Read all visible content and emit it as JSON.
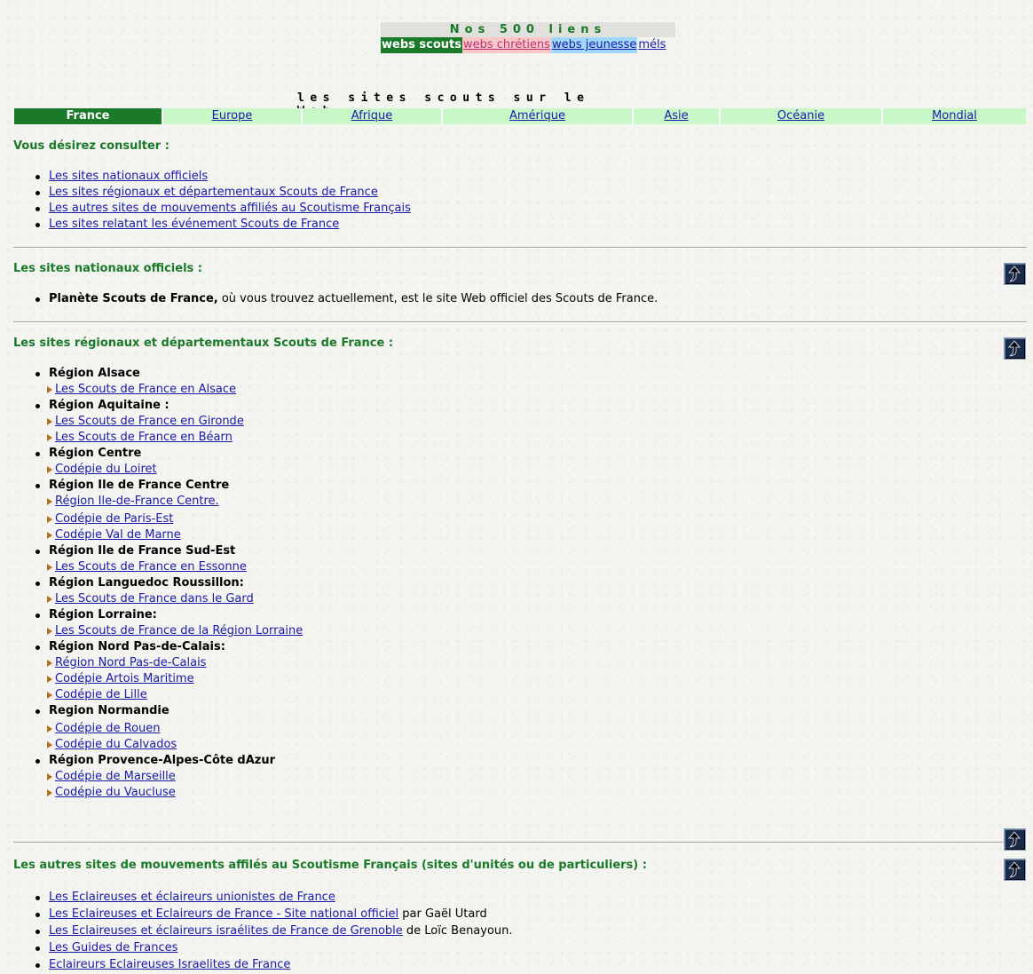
{
  "top": {
    "title": "Nos 500 liens",
    "tabs": [
      "webs scouts",
      "webs chrétiens",
      "webs jeunesse",
      "méls"
    ]
  },
  "headline": "les sites scouts sur le Web",
  "regions": [
    "France",
    "Europe",
    "Afrique",
    "Amérique",
    "Asie",
    "Océanie",
    "Mondial"
  ],
  "intro": {
    "title": "Vous désirez consulter :",
    "items": [
      "Les sites nationaux officiels",
      "Les sites régionaux et départementaux Scouts de France",
      "Les autres sites de mouvements affiliés au Scoutisme Français",
      "Les sites relatant les événement Scouts de France"
    ]
  },
  "national": {
    "title": "Les sites nationaux officiels :",
    "bold": "Planète Scouts de France,",
    "text": " où vous trouvez actuellement, est le site Web officiel des Scouts de France."
  },
  "regional": {
    "title": "Les sites régionaux et départementaux Scouts de France :",
    "groups": [
      {
        "name": "Région Alsace",
        "links": [
          "Les Scouts de France en Alsace"
        ]
      },
      {
        "name": "Région Aquitaine :",
        "links": [
          "Les Scouts de France en Gironde",
          "Les Scouts de France en Béarn"
        ]
      },
      {
        "name": "Région Centre",
        "links": [
          "Codépie du Loiret"
        ]
      },
      {
        "name": "Région Ile de France Centre",
        "links": [
          "Région Ile-de-France Centre.",
          "Codépie de Paris-Est",
          "Codépie Val de Marne"
        ]
      },
      {
        "name": "Région Ile de France Sud-Est",
        "links": [
          "Les Scouts de France en Essonne"
        ]
      },
      {
        "name": "Région Languedoc Roussillon:",
        "links": [
          "Les Scouts de France dans le Gard"
        ]
      },
      {
        "name": "Région Lorraine:",
        "links": [
          "Les Scouts de France de la Région Lorraine"
        ]
      },
      {
        "name": "Région Nord Pas-de-Calais:",
        "links": [
          "Région Nord Pas-de-Calais",
          "Codépie Artois Maritime",
          "Codépie de Lille"
        ]
      },
      {
        "name": "Region Normandie",
        "links": [
          "Codépie de Rouen",
          "Codépie du Calvados"
        ]
      },
      {
        "name": "Région Provence-Alpes-Côte dAzur",
        "links": [
          "Codépie de Marseille",
          "Codépie du Vaucluse"
        ]
      }
    ]
  },
  "others": {
    "title": "Les autres sites de mouvements affilés au Scoutisme Français (sites d'unités ou de particuliers) :",
    "items": [
      {
        "link": "Les Eclaireuses et éclaireurs unionistes de France",
        "suffix": ""
      },
      {
        "link": "Les Eclaireuses et Eclaireurs de France - Site national officiel",
        "suffix": " par Gaël Utard"
      },
      {
        "link": "Les Eclaireuses et éclaireurs israélites de France de Grenoble",
        "suffix": " de Loïc Benayoun."
      },
      {
        "link": "Les Guides de Frances",
        "suffix": ""
      },
      {
        "link": "Eclaireurs Eclaireuses Israelites de France",
        "suffix": ""
      }
    ]
  }
}
